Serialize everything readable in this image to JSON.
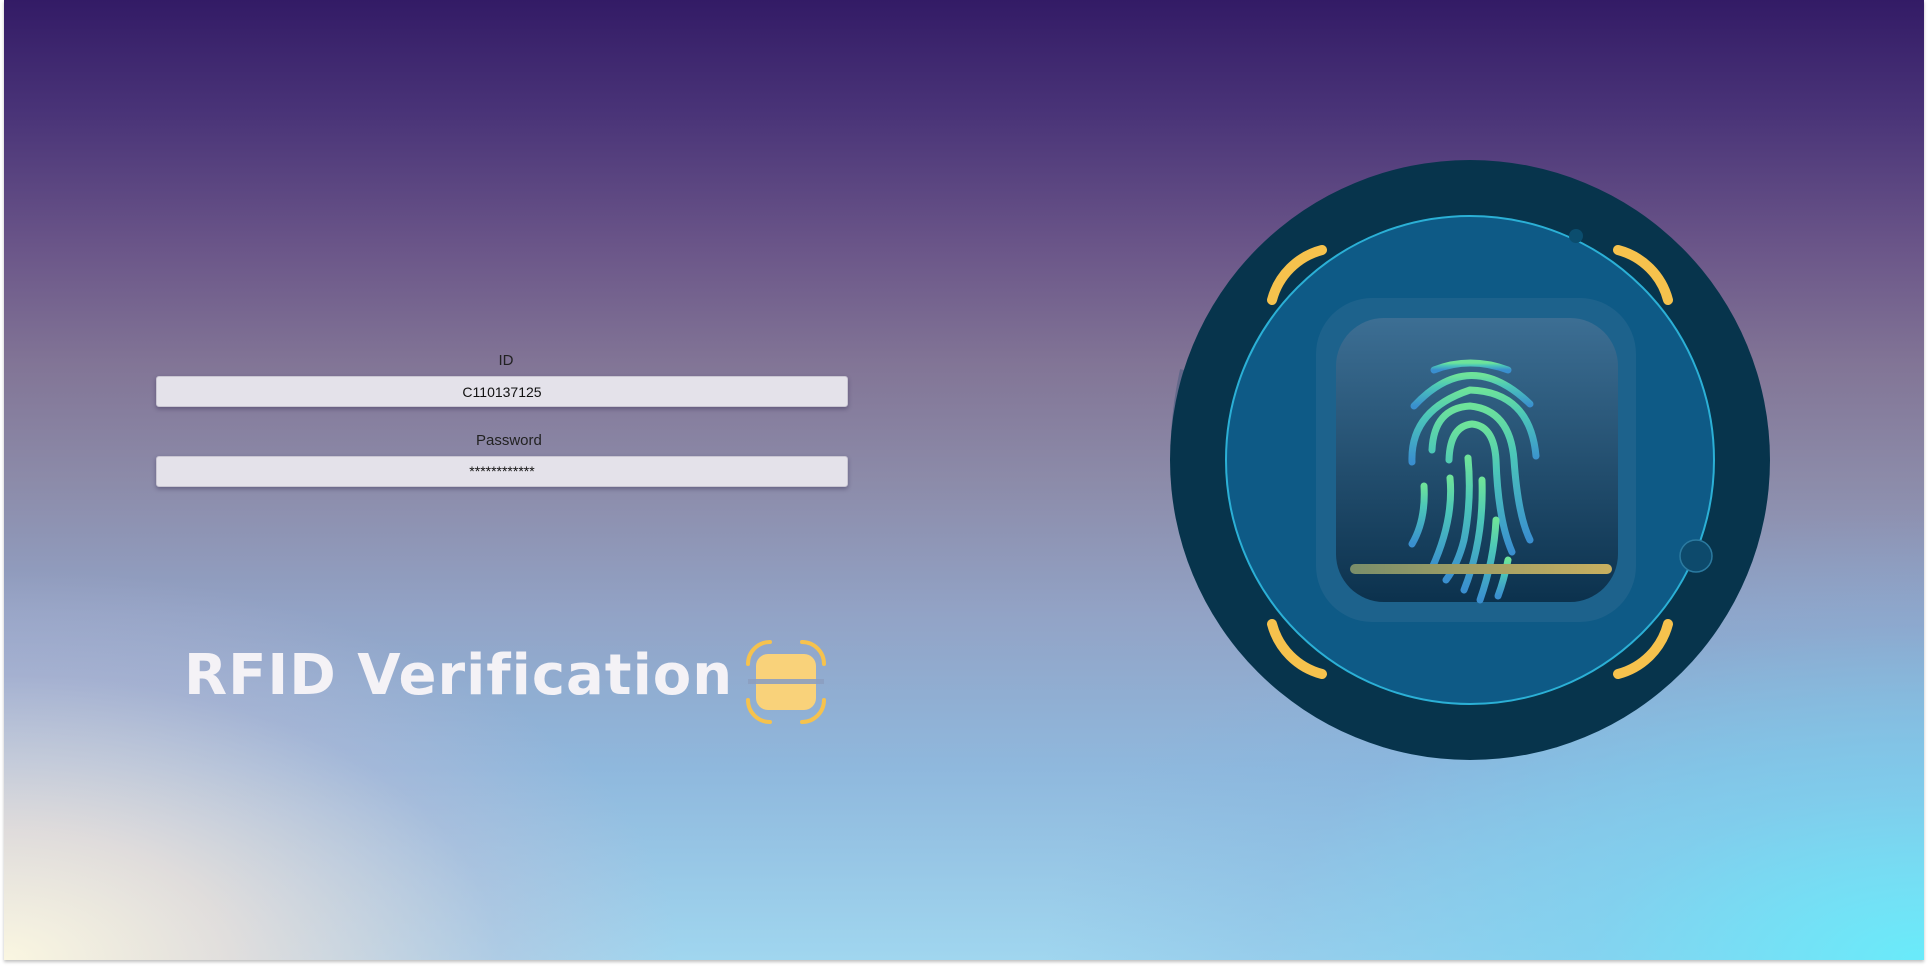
{
  "form": {
    "id_label": "ID",
    "id_value": "C110137125",
    "password_label": "Password",
    "password_value": "************"
  },
  "hero": {
    "title": "RFID Verification"
  },
  "icons": {
    "scan": "rfid-scan-icon",
    "fingerprint": "fingerprint-icon"
  },
  "colors": {
    "accent_yellow": "#f6c24d",
    "scanner_ring": "#07344c",
    "scanner_inner": "#0e5a86",
    "fingerprint_green": "#5ee39a",
    "fingerprint_blue": "#3fa2d3"
  }
}
